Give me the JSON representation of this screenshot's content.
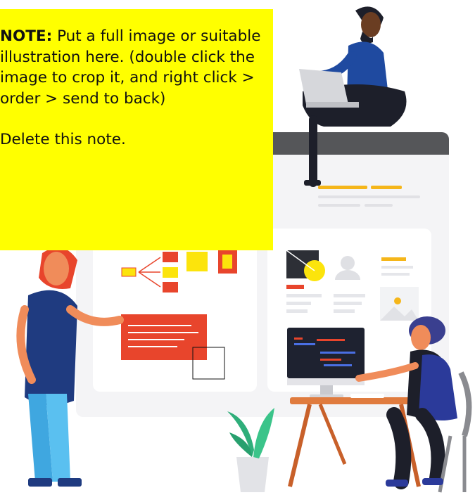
{
  "note": {
    "label": "NOTE:",
    "text": "Put a full image or suitable illustration here. (double click the image to crop it, and right click > order > send to back)",
    "delete_text": "Delete this note."
  },
  "illustration": {
    "description_icons": [
      "laptop-user-icon",
      "presenter-icon",
      "developer-icon",
      "plant-icon",
      "web-page-mockup-icon"
    ]
  },
  "colors": {
    "note_background": "#ffff00",
    "accent_orange": "#f5a623",
    "accent_red": "#e8452c",
    "navy": "#1f3b80",
    "skin": "#f08c5a"
  }
}
